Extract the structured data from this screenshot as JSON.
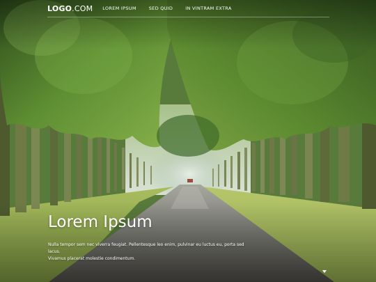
{
  "header": {
    "logo_bold": "LOGO",
    "logo_rest": ".COM",
    "nav": [
      {
        "label": "LOREM IPSUM"
      },
      {
        "label": "SED QUID"
      },
      {
        "label": "IN VINTRAM EXTRA"
      }
    ]
  },
  "hero": {
    "title": "Lorem Ipsum",
    "body_line1": "Nulla tempor sem nec viverra feugiat. Pellentesque leo enim, pulvinar eu luctus eu, porta sed lacus.",
    "body_line2": "Vivamus placerat molestie condimentum.",
    "background_icon": "tree-lined-road-photo",
    "scroll_icon": "chevron-down-icon"
  },
  "colors": {
    "text": "#ffffff",
    "foliage": "#4f7a2c",
    "grass": "#9cb35a",
    "road": "#6e6d66"
  }
}
